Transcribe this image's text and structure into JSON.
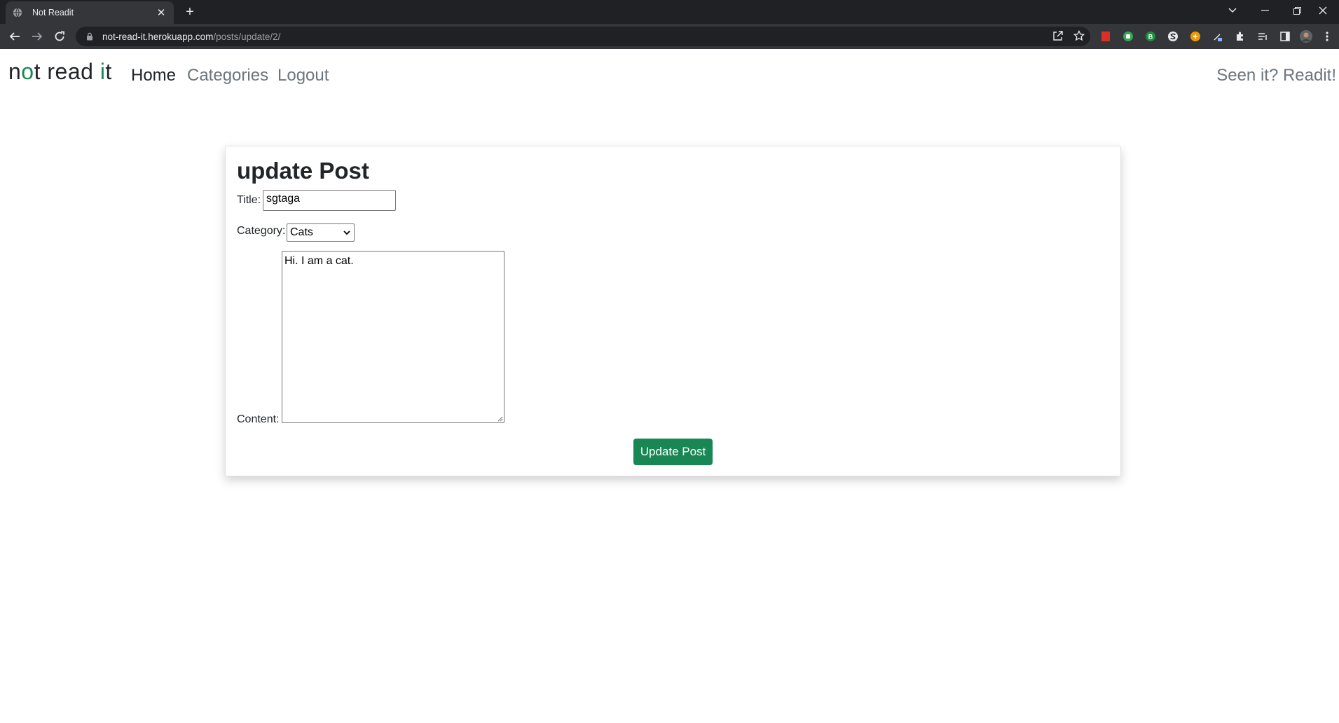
{
  "browser": {
    "tab_title": "Not Readit",
    "url_host": "not-read-it.herokuapp.com",
    "url_path": "/posts/update/2/"
  },
  "site": {
    "brand_parts": [
      "n",
      "o",
      "t read ",
      "i",
      "t"
    ],
    "nav": [
      {
        "label": "Home",
        "active": true
      },
      {
        "label": "Categories",
        "active": false
      },
      {
        "label": "Logout",
        "active": false
      }
    ],
    "slogan": "Seen it? Readit!"
  },
  "form": {
    "heading": "update Post",
    "title_label": "Title:",
    "title_value": "sgtaga",
    "category_label": "Category:",
    "category_value": "Cats",
    "content_label": "Content:",
    "content_value": "Hi. I am a cat.",
    "submit_label": "Update Post"
  },
  "colors": {
    "accent": "#198754",
    "chrome_dark": "#202124",
    "chrome_toolbar": "#35363a"
  }
}
